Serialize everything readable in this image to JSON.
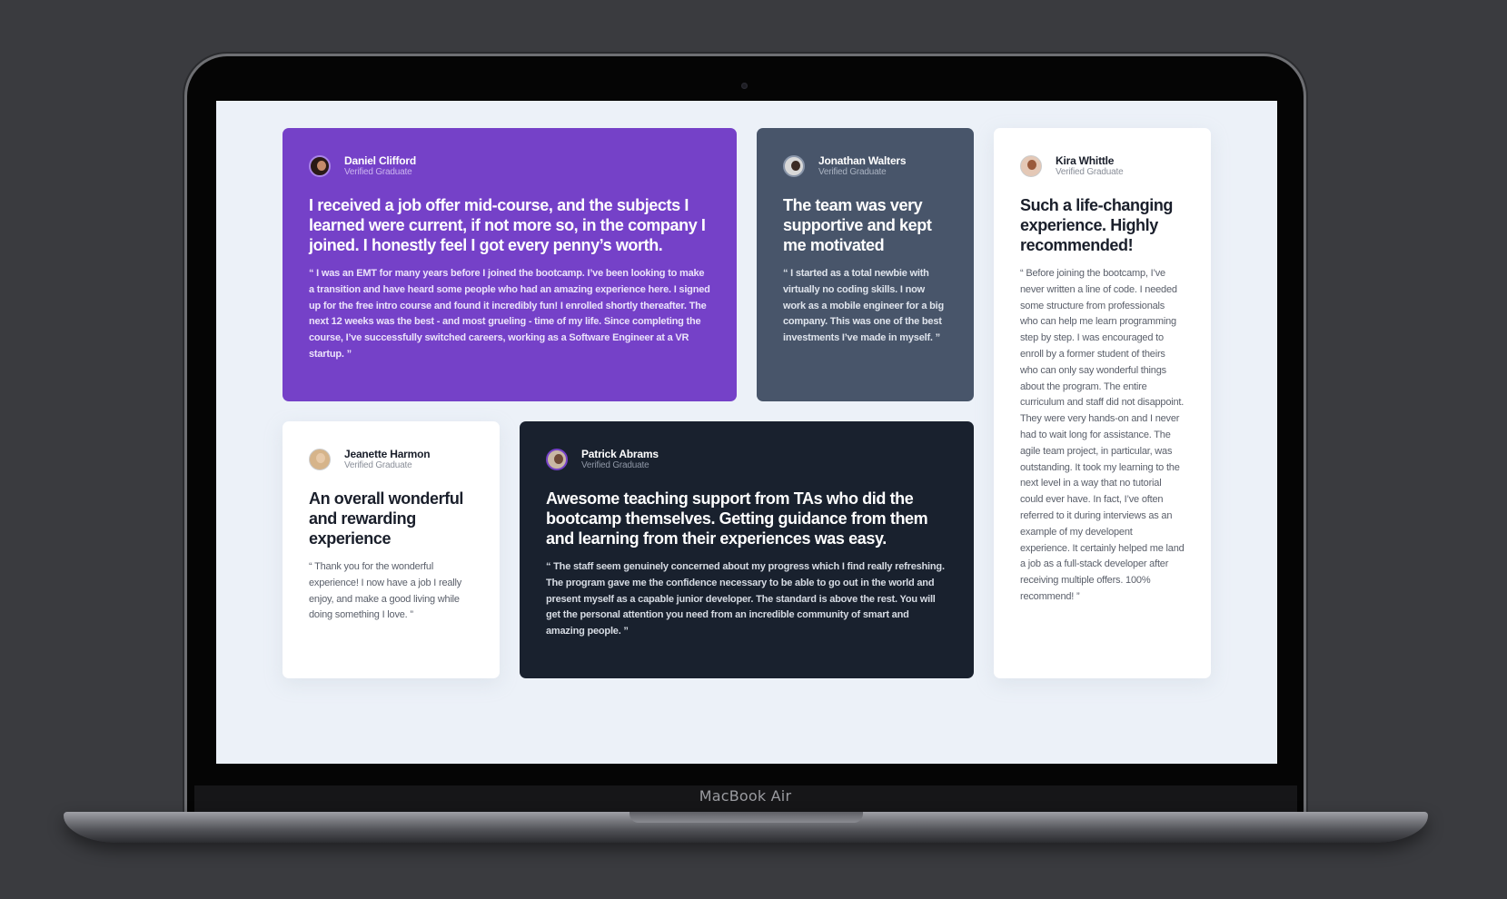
{
  "device": {
    "brand": "MacBook Air"
  },
  "testimonials": [
    {
      "name": "Daniel Clifford",
      "role": "Verified Graduate",
      "headline": "I received a job offer mid-course, and the subjects I learned were current, if not more so, in the company I joined. I honestly feel I got every penny’s worth.",
      "quote": "“ I was an EMT for many years before I joined the bootcamp. I’ve been looking to make a transition and have heard some people who had an amazing experience here. I signed up for the free intro course and found it incredibly fun! I enrolled shortly thereafter. The next 12 weeks was the best - and most grueling - time of my life. Since completing the course, I’ve successfully switched careers, working as a Software Engineer at a VR startup. ”",
      "theme_color": "#7541c8"
    },
    {
      "name": "Jonathan Walters",
      "role": "Verified Graduate",
      "headline": "The team was very supportive and kept me motivated",
      "quote": "“ I started as a total newbie with virtually no coding skills. I now work as a mobile engineer for a big company. This was one of the best investments I’ve made in myself. ”",
      "theme_color": "#48556a"
    },
    {
      "name": "Kira Whittle",
      "role": "Verified Graduate",
      "headline": "Such a life-changing experience. Highly recommended!",
      "quote": "“ Before joining the bootcamp, I’ve never written a line of code. I needed some structure from professionals who can help me learn programming step by step. I was encouraged to enroll by a former student of theirs who can only say wonderful things about the program. The entire curriculum and staff did not disappoint. They were very hands-on and I never had to wait long for assistance. The agile team project, in particular, was outstanding. It took my learning to the next level in a way that no tutorial could ever have. In fact, I’ve often referred to it during interviews as an example of my developent experience. It certainly helped me land a job as a full-stack developer after receiving multiple offers. 100% recommend! ”",
      "theme_color": "#ffffff"
    },
    {
      "name": "Jeanette Harmon",
      "role": "Verified Graduate",
      "headline": "An overall wonderful and rewarding experience",
      "quote": "“ Thank you for the wonderful experience! I now have a job I really enjoy, and make a good living while doing something I love. ”",
      "theme_color": "#ffffff"
    },
    {
      "name": "Patrick Abrams",
      "role": "Verified Graduate",
      "headline": "Awesome teaching support from TAs who did the bootcamp themselves. Getting guidance from them and learning from their experiences was easy.",
      "quote": "“ The staff seem genuinely concerned about my progress which I find really refreshing. The program gave me the confidence necessary to be able to go out in the world and present myself as a capable junior developer. The standard is above the rest. You will get the personal attention you need from an incredible community of smart and amazing people. ”",
      "theme_color": "#19212e"
    }
  ]
}
